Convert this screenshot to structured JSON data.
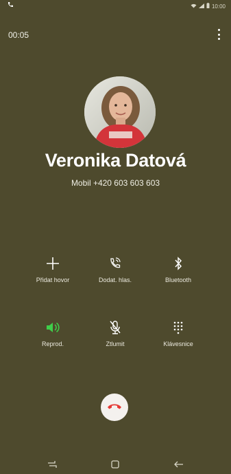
{
  "status_bar": {
    "call_icon": "phone-icon",
    "time": "10:00",
    "icons": [
      "wifi-icon",
      "signal-icon",
      "battery-icon"
    ]
  },
  "call": {
    "timer": "00:05",
    "contact_name": "Veronika Datová",
    "number_line": "Mobil  +420 603 603 603"
  },
  "actions": [
    {
      "label": "Přidat hovor",
      "icon": "add-call-icon",
      "active": false
    },
    {
      "label": "Dodat. hlas.",
      "icon": "voicemail-call-icon",
      "active": false
    },
    {
      "label": "Bluetooth",
      "icon": "bluetooth-icon",
      "active": false
    },
    {
      "label": "Reprod.",
      "icon": "speaker-icon",
      "active": true
    },
    {
      "label": "Ztlumit",
      "icon": "mute-mic-icon",
      "active": false
    },
    {
      "label": "Klávesnice",
      "icon": "keypad-icon",
      "active": false
    }
  ],
  "colors": {
    "background": "#4e4a2d",
    "active_green": "#3fce4a",
    "end_call_red": "#e53935"
  },
  "nav_bar": [
    "recent-apps-icon",
    "home-icon",
    "back-icon"
  ]
}
